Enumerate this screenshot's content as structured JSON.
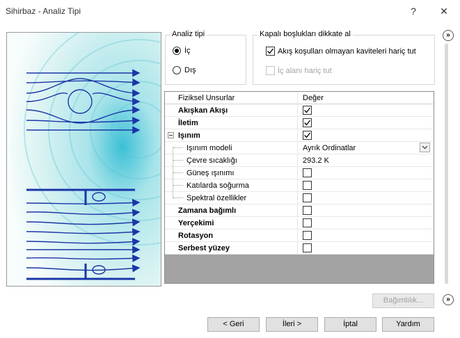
{
  "window": {
    "title": "Sihirbaz - Analiz Tipi",
    "help": "?",
    "close": "✕"
  },
  "analysis_type": {
    "title": "Analiz tipi",
    "options": [
      {
        "label": "İç",
        "selected": true
      },
      {
        "label": "Dış",
        "selected": false
      }
    ]
  },
  "closed_cavities": {
    "title": "Kapalı boşlukları dikkate al",
    "exclude_no_flow": {
      "label": "Akış koşulları olmayan kaviteleri hariç tut",
      "checked": true
    },
    "exclude_internal": {
      "label": "İç alanı hariç tut",
      "checked": false,
      "disabled": true
    }
  },
  "grid": {
    "headers": {
      "col1": "Fiziksel Unsurlar",
      "col2": "Değer"
    },
    "rows": [
      {
        "label": "Akışkan Akışı",
        "bold": true,
        "checked": true
      },
      {
        "label": "İletim",
        "bold": true,
        "checked": true
      },
      {
        "label": "Işınım",
        "bold": true,
        "checked": true
      },
      {
        "label": "Işınım modeli",
        "value": "Ayrık Ordinatlar"
      },
      {
        "label": "Çevre sıcaklığı",
        "value": "293.2 K"
      },
      {
        "label": "Güneş ışınımı",
        "checked": false
      },
      {
        "label": "Katılarda soğurma",
        "checked": false
      },
      {
        "label": "Spektral özellikler",
        "checked": false
      },
      {
        "label": "Zamana bağımlı",
        "bold": true,
        "checked": false
      },
      {
        "label": "Yerçekimi",
        "bold": true,
        "checked": false
      },
      {
        "label": "Rotasyon",
        "bold": true,
        "checked": false
      },
      {
        "label": "Serbest yüzey",
        "bold": true,
        "checked": false
      }
    ]
  },
  "side_buttons": {
    "top": "»",
    "bottom": "»"
  },
  "dependency_button": "Bağımlılık...",
  "footer": {
    "back": "< Geri",
    "next": "İleri >",
    "cancel": "İptal",
    "help": "Yardım"
  },
  "colors": {
    "flow_lines": "#1a36a8",
    "accent": "#2a45c2"
  }
}
